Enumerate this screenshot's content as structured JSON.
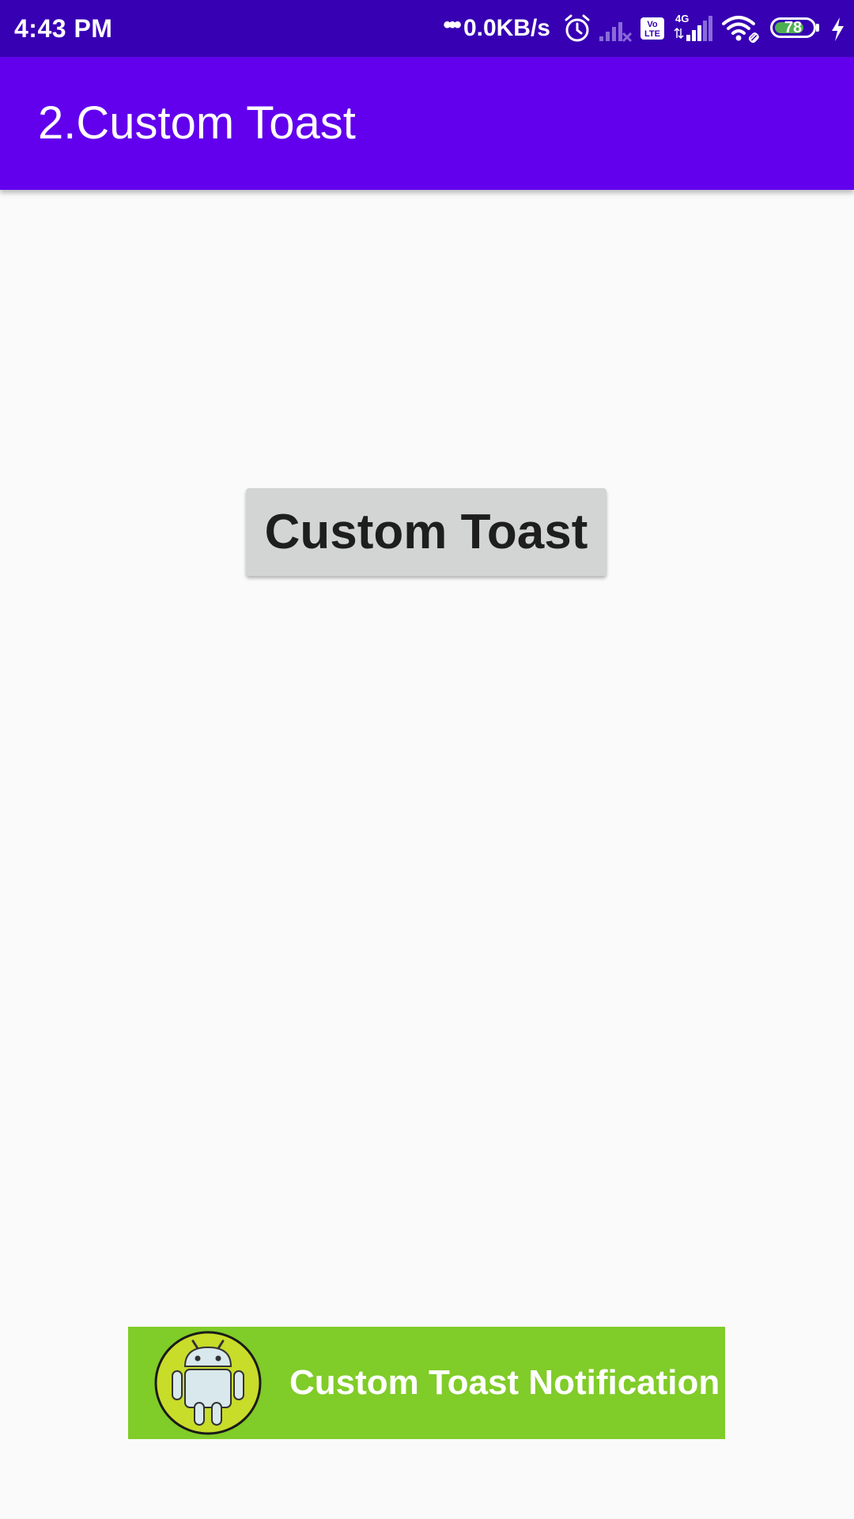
{
  "status_bar": {
    "time": "4:43 PM",
    "network_dots": "•••",
    "network_speed": "0.0KB/s",
    "icons": [
      "alarm-icon",
      "no-signal-icon",
      "volte-icon",
      "4g-signal-icon",
      "wifi-icon",
      "battery-icon",
      "charging-icon"
    ],
    "network_type": "4G",
    "volte_label_top": "Vo",
    "volte_label_bottom": "LTE",
    "battery_level": "78",
    "battery_percent": 78
  },
  "app_bar": {
    "title": "2.Custom Toast",
    "color": "#6200ee"
  },
  "main": {
    "button_label": "Custom Toast"
  },
  "toast": {
    "message": "Custom Toast Notification",
    "icon": "android-robot-icon",
    "background": "#80cc28"
  },
  "colors": {
    "status_bar": "#3700b3",
    "app_bar": "#6200ee",
    "background": "#fafafa",
    "button": "#d3d4d4",
    "toast": "#80cc28",
    "battery_fill": "#4caf50"
  }
}
